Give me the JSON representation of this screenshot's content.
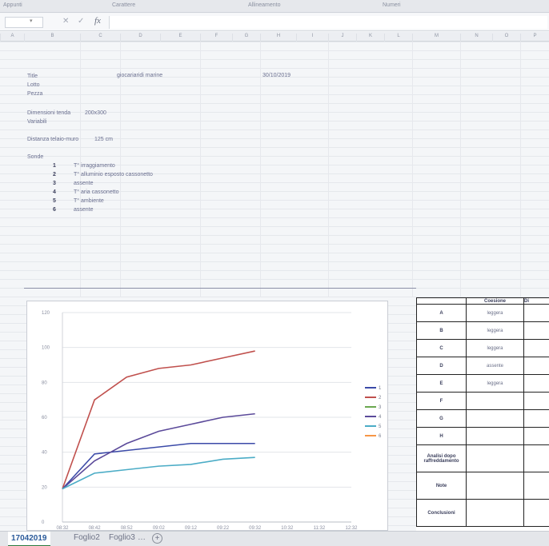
{
  "ribbon": {
    "groups": [
      "Appunti",
      "Carattere",
      "Allineamento",
      "Numeri"
    ]
  },
  "formula_bar": {
    "cancel": "✕",
    "confirm": "✓",
    "fx": "fx"
  },
  "columns": [
    "B",
    "C",
    "D",
    "E",
    "F",
    "G",
    "H",
    "I",
    "J",
    "K",
    "L",
    "M",
    "N",
    "O",
    "P"
  ],
  "cells": {
    "title_label": "Title",
    "title_value": "giocariaridi marine",
    "date": "30/10/2019",
    "lotto": "Lotto",
    "pezza": "Pezza",
    "dimensions_label": "Dimensioni tenda",
    "dimensions_value": "200x300",
    "variabili": "Variabili",
    "distance_label": "Distanza telaio-muro",
    "distance_value": "125 cm",
    "sonde_label": "Sonde",
    "sonde": [
      {
        "n": "1",
        "text": "T° irraggiamento"
      },
      {
        "n": "2",
        "text": "T° alluminio esposto cassonetto"
      },
      {
        "n": "3",
        "text": "assente"
      },
      {
        "n": "4",
        "text": "T° aria cassonetto"
      },
      {
        "n": "5",
        "text": "T° ambiente"
      },
      {
        "n": "6",
        "text": "assente"
      }
    ]
  },
  "chart_data": {
    "type": "line",
    "x": [
      "08:32",
      "08:42",
      "08:52",
      "09:02",
      "09:12",
      "09:22",
      "09:32",
      "10:32",
      "11:32",
      "12:32"
    ],
    "ylim": [
      0,
      120
    ],
    "yticks": [
      0,
      20,
      40,
      60,
      80,
      100,
      120
    ],
    "grid": true,
    "legend": "right",
    "series": [
      {
        "name": "1",
        "color": "#3b4aa8",
        "values": [
          19,
          39,
          41,
          43,
          45,
          45,
          45,
          null,
          null,
          null
        ]
      },
      {
        "name": "2",
        "color": "#c0504d",
        "values": [
          19,
          70,
          83,
          88,
          90,
          94,
          98,
          null,
          null,
          null
        ]
      },
      {
        "name": "3",
        "color": "#6aa84f",
        "values": [
          null,
          null,
          null,
          null,
          null,
          null,
          null,
          null,
          null,
          null
        ]
      },
      {
        "name": "4",
        "color": "#5b4a9a",
        "values": [
          19,
          35,
          45,
          52,
          56,
          60,
          62,
          null,
          null,
          null
        ]
      },
      {
        "name": "5",
        "color": "#4bacc6",
        "values": [
          19,
          28,
          30,
          32,
          33,
          36,
          37,
          null,
          null,
          null
        ]
      },
      {
        "name": "6",
        "color": "#f79646",
        "values": [
          null,
          null,
          null,
          null,
          null,
          null,
          null,
          null,
          null,
          null
        ]
      }
    ]
  },
  "table": {
    "header": [
      "",
      "Coesione",
      "Di"
    ],
    "rows": [
      {
        "label": "A",
        "value": "leggera"
      },
      {
        "label": "B",
        "value": "leggera"
      },
      {
        "label": "C",
        "value": "leggera"
      },
      {
        "label": "D",
        "value": "assente"
      },
      {
        "label": "E",
        "value": "leggera"
      },
      {
        "label": "F",
        "value": ""
      },
      {
        "label": "G",
        "value": ""
      },
      {
        "label": "H",
        "value": ""
      }
    ],
    "analisi": "Analisi dopo raffreddamento",
    "note": "Note",
    "conclusioni": "Conclusioni"
  },
  "sheets": {
    "active": "17042019",
    "others": [
      "Foglio2",
      "Foglio3"
    ],
    "more": "…",
    "add": "+"
  }
}
